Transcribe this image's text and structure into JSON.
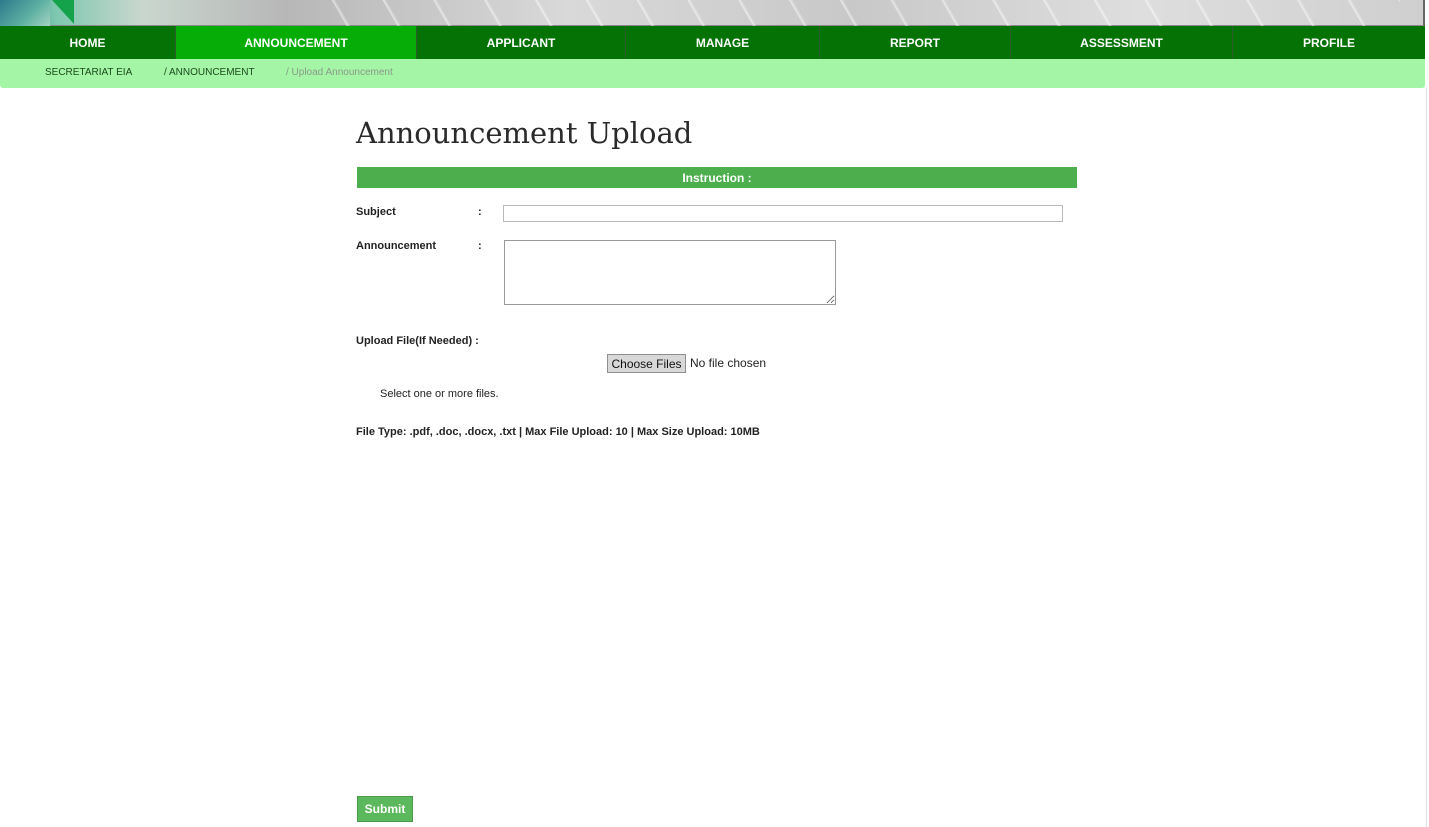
{
  "nav": {
    "items": [
      {
        "label": "HOME"
      },
      {
        "label": "ANNOUNCEMENT"
      },
      {
        "label": "APPLICANT"
      },
      {
        "label": "MANAGE"
      },
      {
        "label": "REPORT"
      },
      {
        "label": "ASSESSMENT"
      },
      {
        "label": "PROFILE"
      }
    ],
    "active": "ANNOUNCEMENT"
  },
  "breadcrumb": {
    "items": [
      "SECRETARIAT EIA",
      "/ ANNOUNCEMENT",
      "/ Upload Announcement"
    ]
  },
  "page": {
    "title": "Announcement Upload",
    "instruction": "Instruction :"
  },
  "form": {
    "subject_label": "Subject",
    "announcement_label": "Announcement",
    "colon": ":",
    "subject_value": "",
    "announcement_value": "",
    "upload_label": "Upload File(If Needed) :",
    "choose_files_label": "Choose Files",
    "file_status": "No file chosen",
    "help_text": "Select one or more files.",
    "file_type_info": "File Type: .pdf, .doc, .docx, .txt | Max File Upload: 10 | Max Size Upload: 10MB",
    "submit_label": "Submit"
  },
  "colors": {
    "nav_bg": "#047204",
    "nav_active": "#07ad07",
    "breadcrumb_bg": "#a4f5a6",
    "instruction_bg": "#4cae4c",
    "submit_bg": "#5cb85c"
  }
}
